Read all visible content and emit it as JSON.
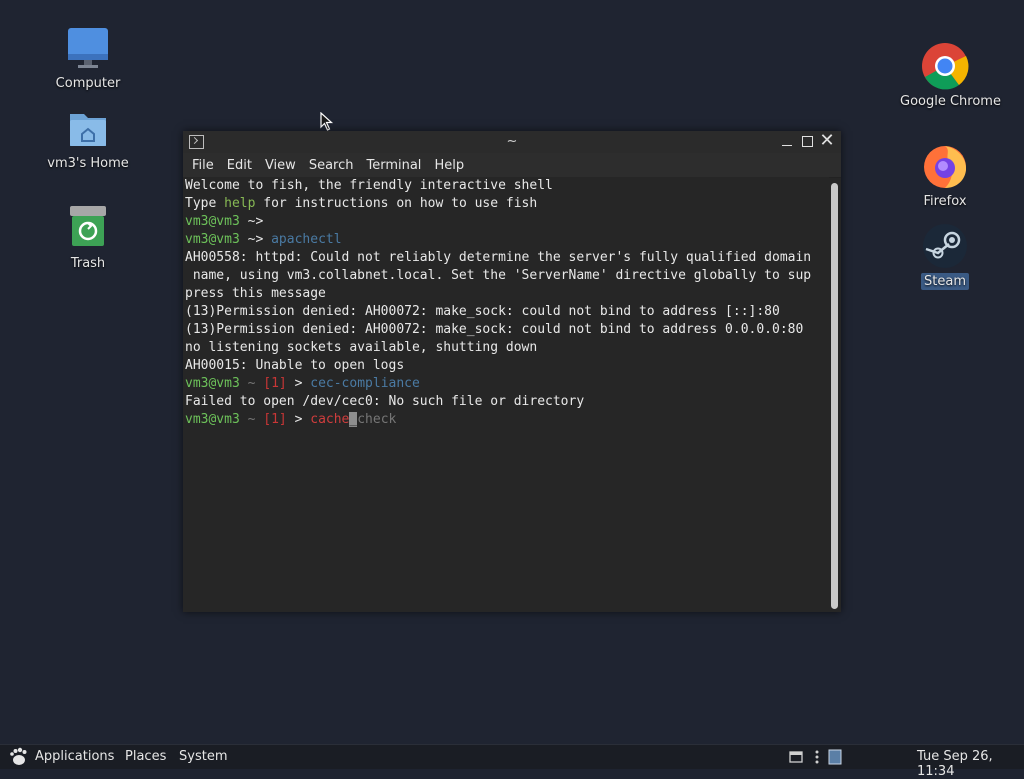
{
  "desktop": {
    "icons": [
      {
        "label": "Computer"
      },
      {
        "label": "vm3's Home"
      },
      {
        "label": "Trash"
      },
      {
        "label": "Google Chrome"
      },
      {
        "label": "Firefox"
      },
      {
        "label": "Steam"
      }
    ]
  },
  "terminal": {
    "title": "~",
    "menu": [
      "File",
      "Edit",
      "View",
      "Search",
      "Terminal",
      "Help"
    ],
    "lines": {
      "l1": "Welcome to fish, the friendly interactive shell",
      "l2a": "Type ",
      "l2b": "help",
      "l2c": " for instructions on how to use fish",
      "prompt": "vm3@vm3",
      "tilde_arrow": " ~>",
      "l4cmd": "apachectl",
      "l5": "AH00558: httpd: Could not reliably determine the server's fully qualified domain",
      "l6": " name, using vm3.collabnet.local. Set the 'ServerName' directive globally to sup",
      "l7": "press this message",
      "l8": "(13)Permission denied: AH00072: make_sock: could not bind to address [::]:80",
      "l9": "(13)Permission denied: AH00072: make_sock: could not bind to address 0.0.0.0:80",
      "l10": "no listening sockets available, shutting down",
      "l11": "AH00015: Unable to open logs",
      "status_tilde": " ~ ",
      "status_code": "[1]",
      "status_arrow": " > ",
      "l12cmd": "cec-compliance",
      "l13": "Failed to open /dev/cec0: No such file or directory",
      "l14typed": "cache",
      "l14cursor": "_",
      "l14suggest": "check"
    }
  },
  "panel": {
    "applications": "Applications",
    "places": "Places",
    "system": "System",
    "clock": "Tue Sep 26, 11:34"
  },
  "colors": {
    "desktop_bg": "#1f2431",
    "terminal_bg": "#262626",
    "prompt_green": "#6dc25a",
    "command_blue": "#4a7aa3",
    "error_red": "#cf3d3d"
  }
}
